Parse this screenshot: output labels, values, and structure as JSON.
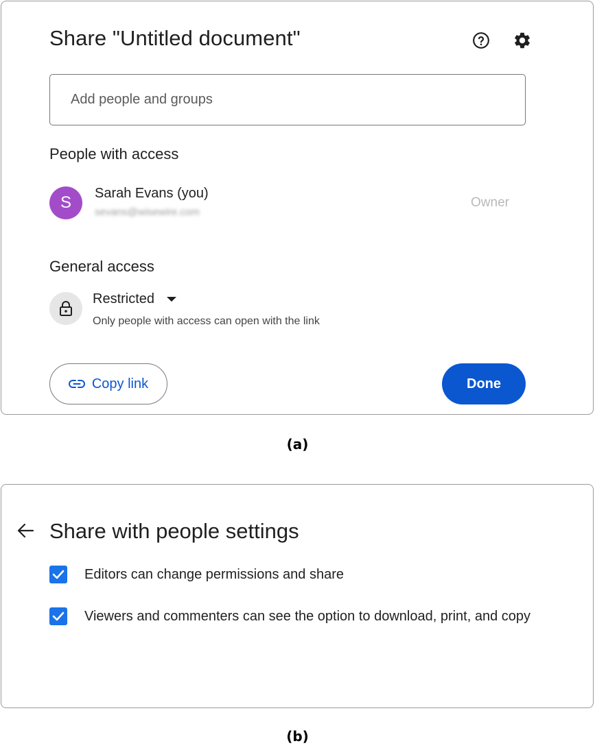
{
  "share_dialog": {
    "title": "Share \"Untitled document\"",
    "help_icon": "help-circle-icon",
    "settings_icon": "gear-icon",
    "add_people_placeholder": "Add people and groups",
    "people_heading": "People with access",
    "person": {
      "initial": "S",
      "name": "Sarah Evans (you)",
      "email": "sevans@wisewire.com",
      "role": "Owner",
      "avatar_color": "#a34cc9"
    },
    "general_heading": "General access",
    "access": {
      "icon": "lock-icon",
      "value": "Restricted",
      "description": "Only people with access can open with the link"
    },
    "copy_link_label": "Copy link",
    "copy_link_icon": "link-icon",
    "done_label": "Done",
    "accent_color": "#0b57d0"
  },
  "settings_dialog": {
    "back_icon": "arrow-left-icon",
    "title": "Share with people settings",
    "options": [
      {
        "label": "Editors can change permissions and share",
        "checked": true
      },
      {
        "label": "Viewers and commenters can see the option to download, print, and copy",
        "checked": true
      }
    ],
    "checkbox_color": "#1a73e8"
  },
  "captions": {
    "a": "(a)",
    "b": "(b)"
  }
}
